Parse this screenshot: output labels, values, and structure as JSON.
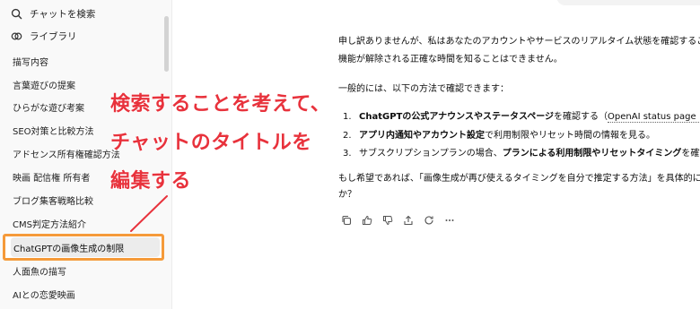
{
  "sidebar": {
    "search_label": "チャットを検索",
    "library_label": "ライブラリ",
    "items": [
      {
        "label": "描写内容"
      },
      {
        "label": "言葉遊びの提案"
      },
      {
        "label": "ひらがな遊び考案"
      },
      {
        "label": "SEO対策と比較方法"
      },
      {
        "label": "アドセンス所有権確認方法"
      },
      {
        "label": "映画 配信権 所有者"
      },
      {
        "label": "ブログ集客戦略比較"
      },
      {
        "label": "CMS判定方法紹介"
      },
      {
        "label": "ChatGPTの画像生成の制限",
        "editing": true
      },
      {
        "label": "人面魚の描写"
      },
      {
        "label": "AIとの恋愛映画"
      }
    ]
  },
  "message": {
    "line1": "申し訳ありませんが、私はあなたのアカウントやサービスのリアルタイム状態を確認することは",
    "line2": "機能が解除される正確な時間を知ることはできません。",
    "line3": "一般的には、以下の方法で確認できます：",
    "list": [
      {
        "num": "1.",
        "bold": "ChatGPTの公式アナウンスやステータスページ",
        "rest": "を確認する（",
        "link": "OpenAI status page ↗"
      },
      {
        "num": "2.",
        "bold": "アプリ内通知やアカウント設定",
        "rest": "で利用制限やリセット時間の情報を見る。",
        "link": ""
      },
      {
        "num": "3.",
        "plain_before": "サブスクリプションプランの場合、",
        "bold": "プランによる利用制限やリセットタイミング",
        "rest": "を確認する",
        "link": ""
      }
    ],
    "closing1": "もし希望であれば、「画像生成が再び使えるタイミングを自分で推定する方法」を具体的に",
    "closing2": "か？"
  },
  "message_actions": [
    {
      "icon": "copy-icon"
    },
    {
      "icon": "thumbs-up-icon"
    },
    {
      "icon": "thumbs-down-icon"
    },
    {
      "icon": "share-icon"
    },
    {
      "icon": "regenerate-icon"
    },
    {
      "icon": "more-icon"
    }
  ],
  "annotation": {
    "line1": "検索することを考えて、",
    "line2": "チャットのタイトルを",
    "line3": "編集する",
    "color": "#e8323c",
    "highlight_color": "#f59a3a"
  }
}
